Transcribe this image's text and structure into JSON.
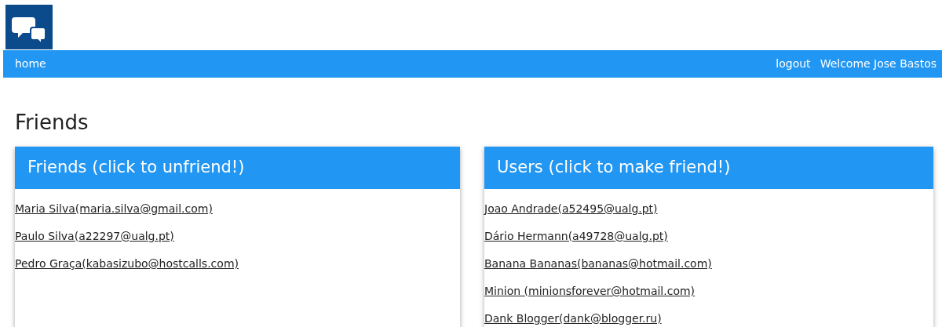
{
  "nav": {
    "left": [
      {
        "label": "home"
      }
    ],
    "right": [
      {
        "label": "logout"
      },
      {
        "label": "Welcome Jose Bastos"
      }
    ]
  },
  "page_title": "Friends",
  "panels": [
    {
      "title": "Friends (click to unfriend!)",
      "items": [
        "Maria Silva(maria.silva@gmail.com)",
        "Paulo Silva(a22297@ualg.pt)",
        "Pedro Graça(kabasizubo@hostcalls.com)"
      ]
    },
    {
      "title": "Users (click to make friend!)",
      "items": [
        "Joao Andrade(a52495@ualg.pt)",
        "Dário Hermann(a49728@ualg.pt)",
        "Banana Bananas(bananas@hotmail.com)",
        "Minion (minionsforever@hotmail.com)",
        "Dank Blogger(dank@blogger.ru)"
      ]
    }
  ]
}
